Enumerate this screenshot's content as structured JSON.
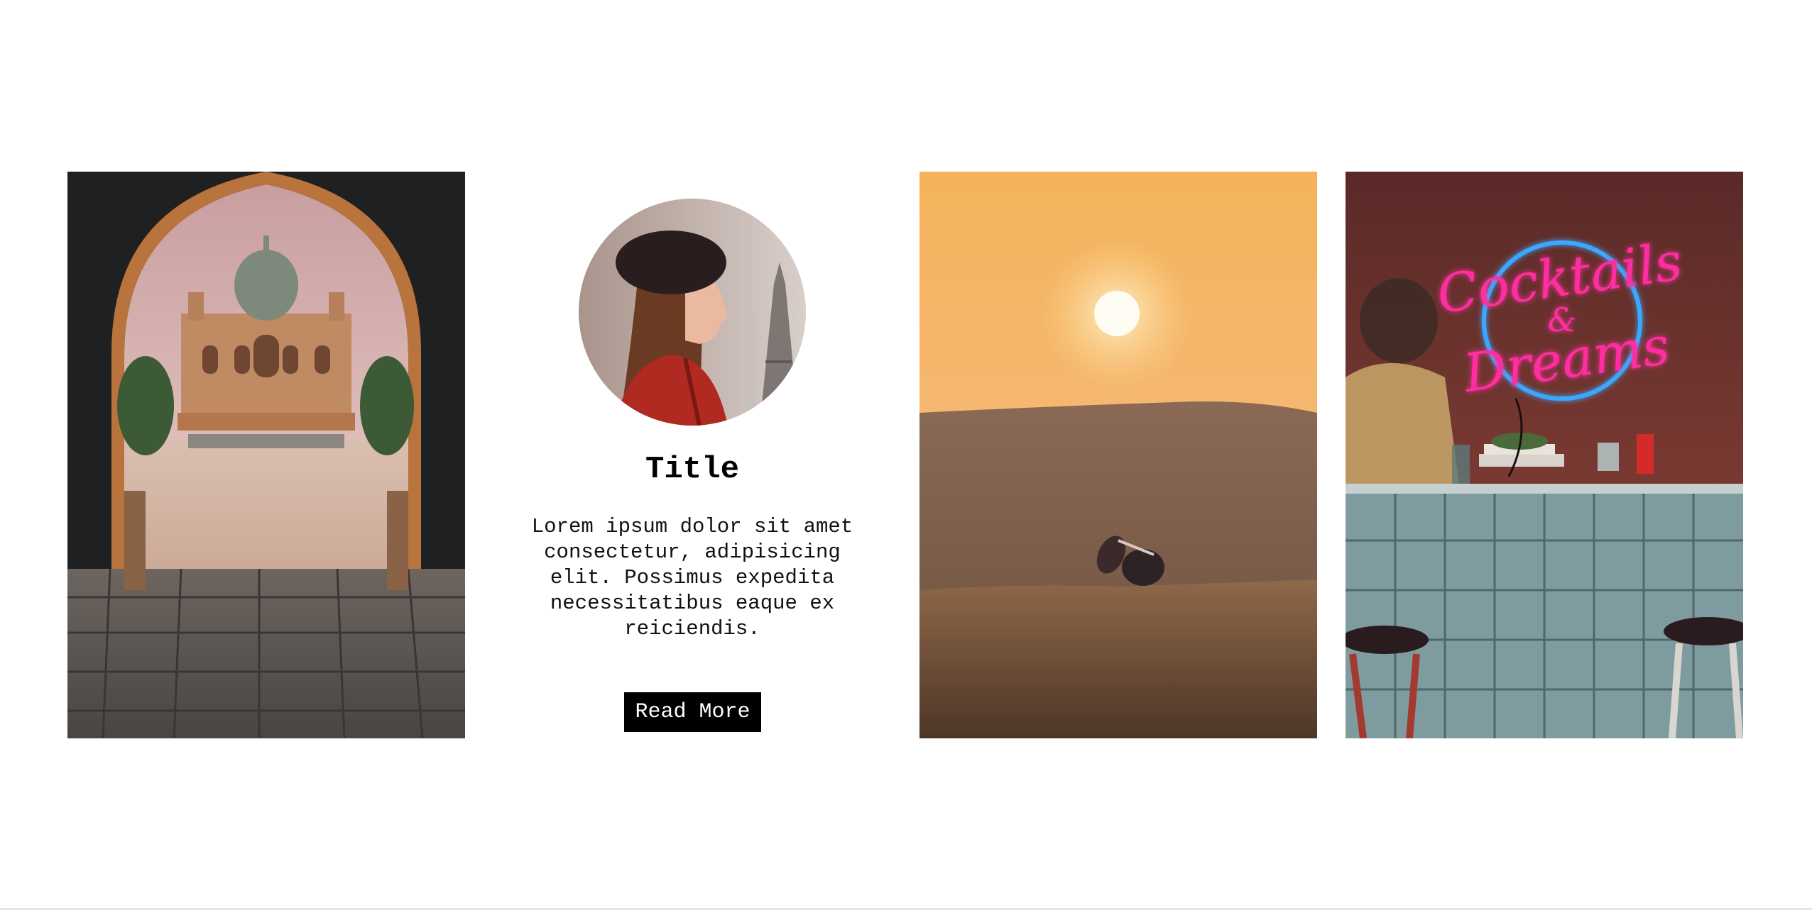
{
  "cards": [
    {
      "type": "image",
      "image": "arch-framed-tomb-photo"
    },
    {
      "type": "text",
      "avatar": "woman-beret-eiffel-photo",
      "title": "Title",
      "body": "Lorem ipsum dolor sit amet consectetur, adipisicing elit. Possimus expedita necessitatibus eaque ex reiciendis.",
      "button_label": "Read More"
    },
    {
      "type": "image",
      "image": "desert-sunset-sunglasses-photo"
    },
    {
      "type": "image",
      "image": "neon-sign-bar-photo",
      "sign_text": [
        "Cocktails",
        "&",
        "Dreams"
      ]
    }
  ],
  "colors": {
    "background": "#ffffff",
    "button_bg": "#000000",
    "button_text": "#ffffff",
    "neon_pink": "#ff2fa0",
    "neon_blue": "#3aa8ff"
  }
}
